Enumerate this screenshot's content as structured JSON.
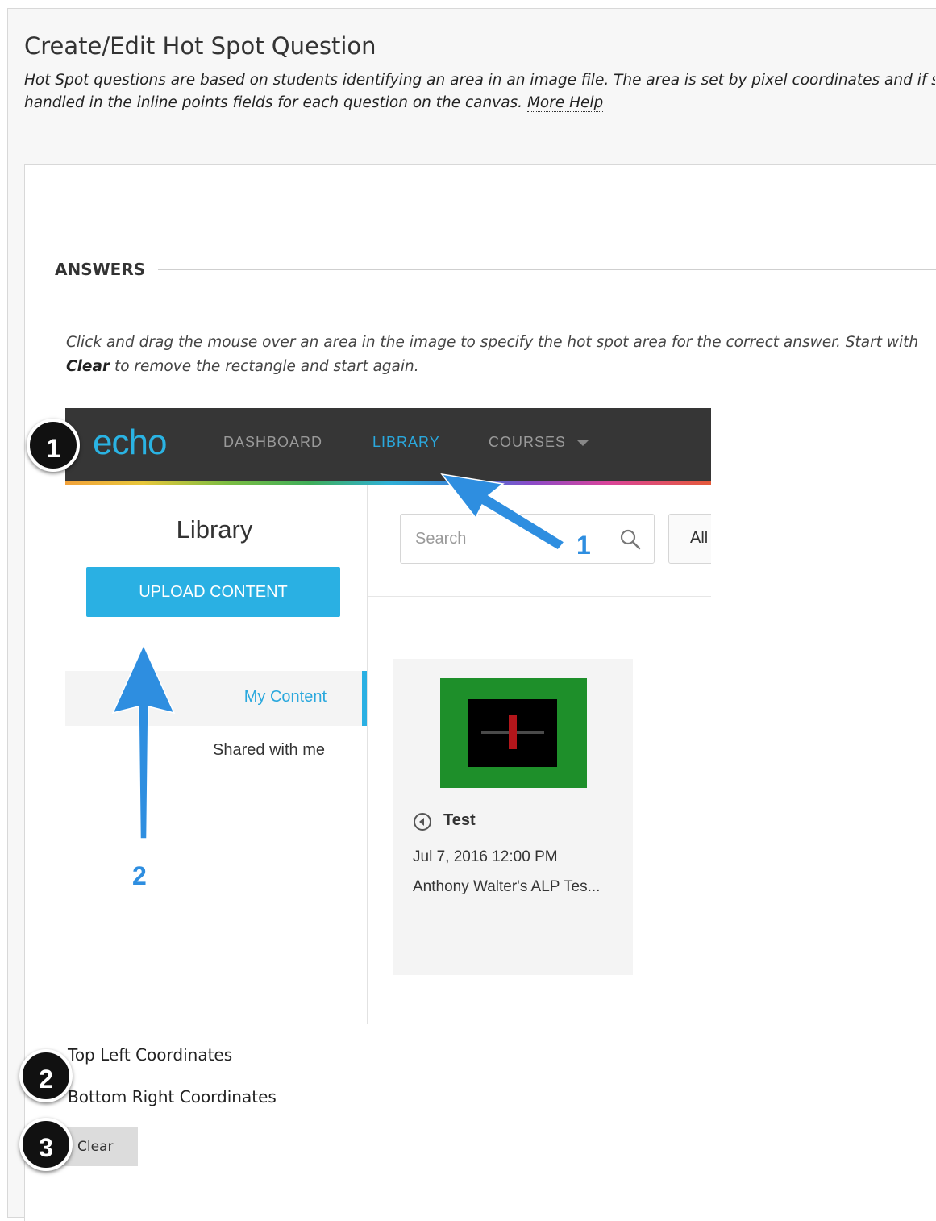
{
  "header": {
    "title": "Create/Edit Hot Spot Question",
    "description_line1": "Hot Spot questions are based on students identifying an area in an image file. The area is set by pixel coordinates and if stude",
    "description_line2": "handled in the inline points fields for each question on the canvas.",
    "more_help": "More Help"
  },
  "answers": {
    "heading": "ANSWERS",
    "instruction_line1": "Click and drag the mouse over an area in the image to specify the hot spot area for the correct answer. Start with",
    "instruction_clear": "Clear",
    "instruction_line2_rest": " to remove the rectangle and start again."
  },
  "echo": {
    "logo": "echo",
    "nav": [
      "DASHBOARD",
      "LIBRARY",
      "COURSES"
    ],
    "active_nav": "LIBRARY",
    "library_title": "Library",
    "upload_button": "UPLOAD CONTENT",
    "sidebar_items": [
      "My Content",
      "Shared with me"
    ],
    "search_placeholder": "Search",
    "filter_button": "All",
    "card": {
      "title": "Test",
      "date": "Jul 7, 2016 12:00 PM",
      "owner": "Anthony Walter's ALP Tes..."
    },
    "accent_color": "#2ab0e3"
  },
  "annotations": {
    "arrow_labels": [
      "1",
      "2"
    ],
    "callouts": [
      "1",
      "2",
      "3"
    ]
  },
  "coordinates": {
    "top_left_label": "Top Left Coordinates",
    "bottom_right_label": "Bottom Right Coordinates"
  },
  "clear_button": "Clear"
}
